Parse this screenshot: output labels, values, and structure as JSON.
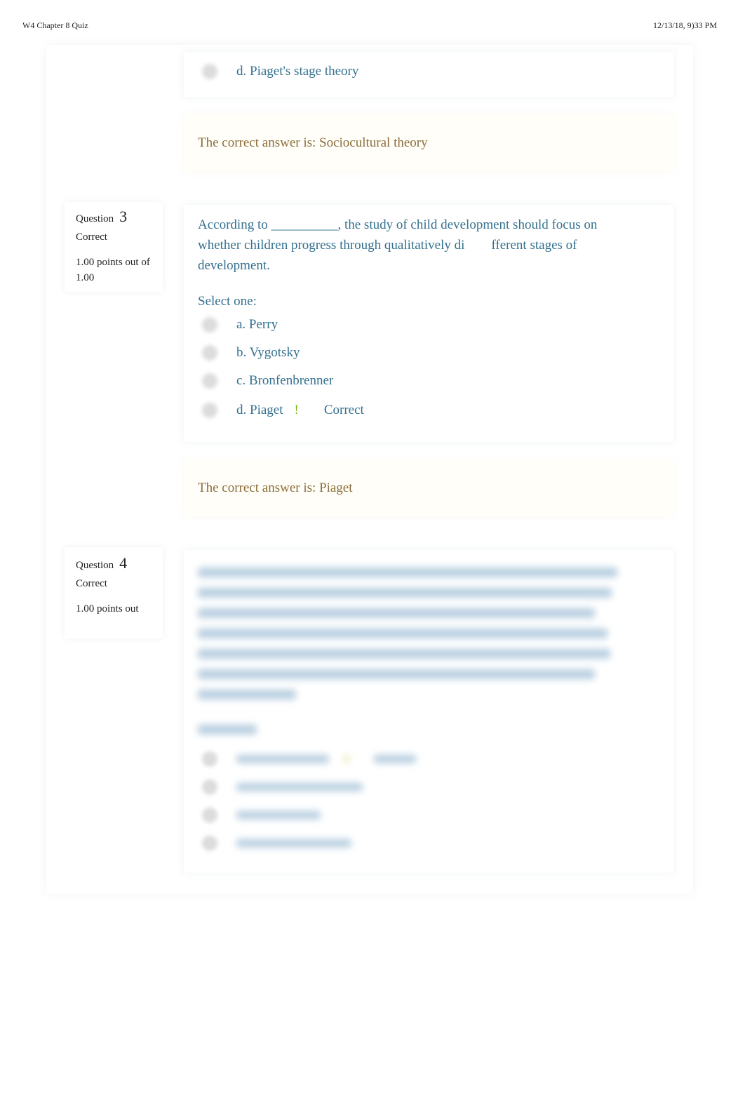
{
  "header": {
    "title": "W4 Chapter 8 Quiz",
    "timestamp": "12/13/18, 9)33 PM"
  },
  "question2_tail": {
    "option_d": "d. Piaget's stage theory",
    "correct_answer": "The correct answer is: Sociocultural theory"
  },
  "question3": {
    "label": "Question",
    "number": "3",
    "state": "Correct",
    "grade": "1.00 points out of 1.00",
    "text_line1": "According to __________, the study of child development should focus on",
    "text_line2": "whether children progress through qualitatively di        fferent stages of",
    "text_line3": "development.",
    "prompt": "Select one:",
    "options": [
      {
        "label": "a. Perry"
      },
      {
        "label": "b. Vygotsky"
      },
      {
        "label": "c. Bronfenbrenner"
      },
      {
        "label": "d. Piaget",
        "mark": "!",
        "feedback": "Correct"
      }
    ],
    "correct_answer": "The correct answer is: Piaget"
  },
  "question4": {
    "label": "Question",
    "number": "4",
    "state": "Correct",
    "grade": "1.00 points out",
    "content_blurred": true
  },
  "colors": {
    "question_text": "#34708f",
    "answer_text": "#8a6d3b",
    "correct_mark": "#7ab51d"
  }
}
